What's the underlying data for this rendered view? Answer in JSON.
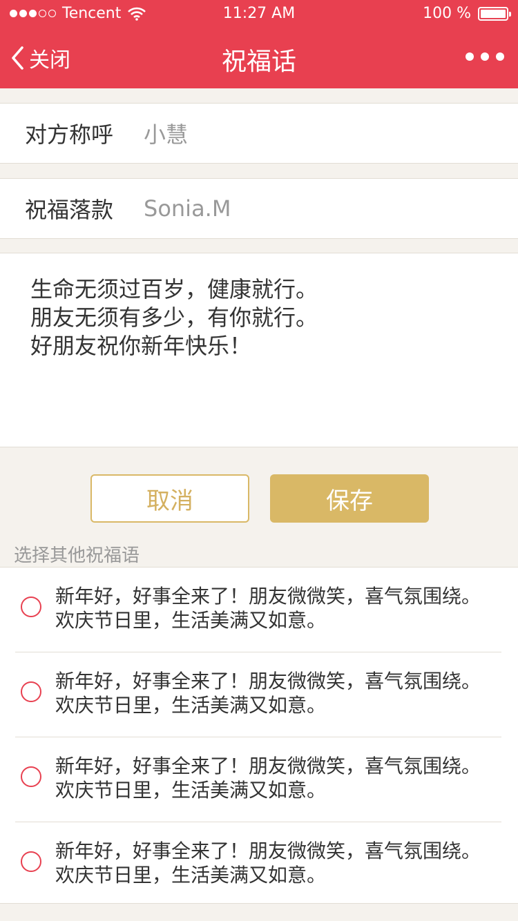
{
  "status_bar": {
    "carrier": "Tencent",
    "time": "11:27 AM",
    "battery": "100 %"
  },
  "nav": {
    "back_label": "关闭",
    "title": "祝福话"
  },
  "fields": {
    "recipient_label": "对方称呼",
    "recipient_value": "小慧",
    "signature_label": "祝福落款",
    "signature_value": "Sonia.M"
  },
  "message": {
    "line1": "生命无须过百岁，健康就行。",
    "line2": "朋友无须有多少，有你就行。",
    "line3": "好朋友祝你新年快乐！"
  },
  "buttons": {
    "cancel": "取消",
    "save": "保存"
  },
  "other_section_title": "选择其他祝福语",
  "options": [
    {
      "line1": "新年好，好事全来了！朋友微微笑，喜气氛围绕。",
      "line2": "欢庆节日里，生活美满又如意。"
    },
    {
      "line1": "新年好，好事全来了！朋友微微笑，喜气氛围绕。",
      "line2": "欢庆节日里，生活美满又如意。"
    },
    {
      "line1": "新年好，好事全来了！朋友微微笑，喜气氛围绕。",
      "line2": "欢庆节日里，生活美满又如意。"
    },
    {
      "line1": "新年好，好事全来了！朋友微微笑，喜气氛围绕。",
      "line2": "欢庆节日里，生活美满又如意。"
    }
  ],
  "colors": {
    "header": "#e84050",
    "gold": "#d9b866",
    "background": "#f5f2ed"
  },
  "icons": {
    "signal": "signal-dots-icon",
    "wifi": "wifi-icon",
    "battery": "battery-icon",
    "back": "chevron-left-icon",
    "more": "more-dots-icon",
    "radio": "radio-circle-icon"
  }
}
